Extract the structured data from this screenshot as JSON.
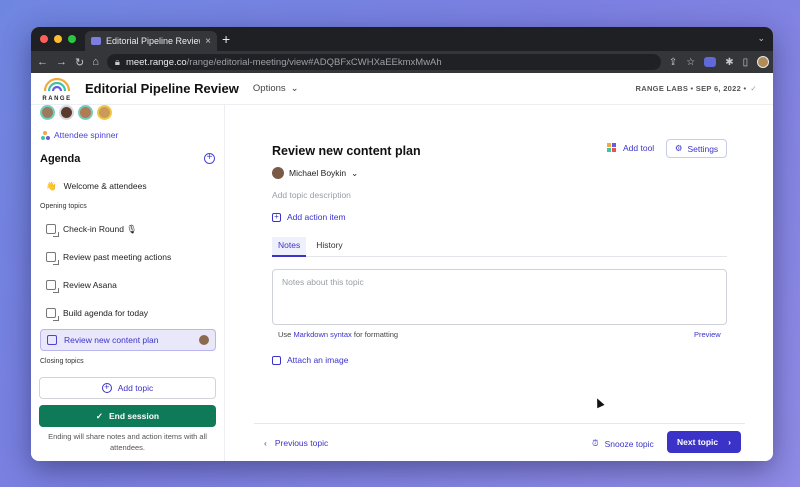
{
  "browser": {
    "tab_title": "Editorial Pipeline Review | Rang",
    "tab_close": "×",
    "new_tab": "+",
    "url_host": "meet.range.co",
    "url_path": "/range/editorial-meeting/view#ADQBFxCWHXaEEkmxMwAh",
    "colors": {
      "close": "#ff5f57",
      "minimize": "#febc2e",
      "maximize": "#28c840"
    }
  },
  "header": {
    "logo_text": "RANGE",
    "title": "Editorial Pipeline Review",
    "options_label": "Options",
    "org_date": "RANGE LABS • SEP 6, 2022 •",
    "saved_mark": "✓"
  },
  "sidebar": {
    "spinner_label": "Attendee spinner",
    "agenda_title": "Agenda",
    "opening_label": "Opening topics",
    "closing_label": "Closing topics",
    "items": [
      {
        "label": "Welcome & attendees",
        "icon": "👋"
      },
      {
        "label": "Check-in Round 🎙"
      },
      {
        "label": "Review past meeting actions"
      },
      {
        "label": "Review Asana"
      },
      {
        "label": "Build agenda for today"
      },
      {
        "label": "Review new content plan"
      }
    ],
    "add_topic_label": "Add topic",
    "end_session_label": "End session",
    "end_note": "Ending will share notes and action items with all attendees."
  },
  "topic": {
    "title": "Review new content plan",
    "add_tool_label": "Add tool",
    "settings_label": "Settings",
    "owner": "Michael Boykin",
    "description_placeholder": "Add topic description",
    "action_item_label": "Add action item",
    "tabs": [
      {
        "label": "Notes"
      },
      {
        "label": "History"
      }
    ],
    "notes_placeholder": "Notes about this topic",
    "md_prefix": "Use",
    "md_link": "Markdown syntax",
    "md_suffix": "for formatting",
    "preview_label": "Preview",
    "attach_label": "Attach an image"
  },
  "footer": {
    "prev_label": "Previous topic",
    "snooze_label": "Snooze topic",
    "next_label": "Next topic"
  },
  "colors": {
    "accent": "#3b33c8",
    "end_session": "#0f7a58",
    "active_item_bg": "#e9e8fb"
  }
}
